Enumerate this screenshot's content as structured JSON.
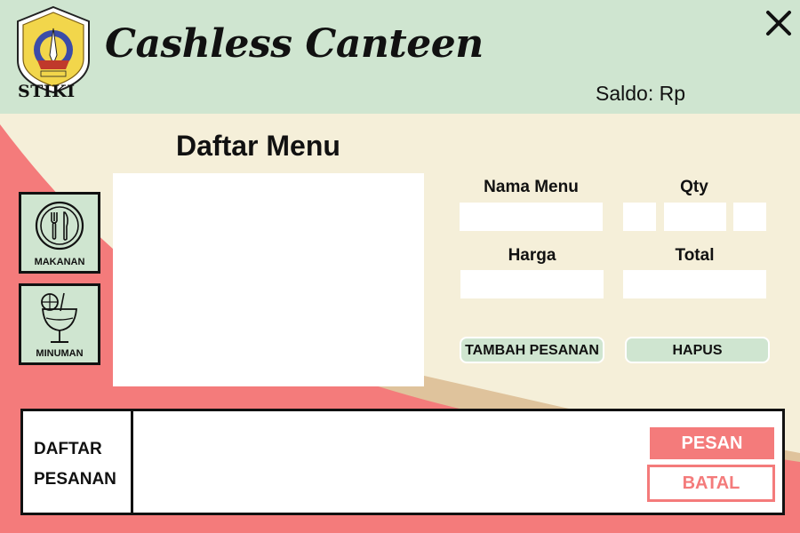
{
  "header": {
    "logo_text": "STIKI",
    "title": "Cashless Canteen",
    "saldo_label": "Saldo: Rp",
    "close_icon": "close-icon"
  },
  "menu": {
    "title": "Daftar Menu",
    "categories": [
      {
        "label": "MAKANAN",
        "icon": "utensils-icon"
      },
      {
        "label": "MINUMAN",
        "icon": "drink-glass-icon"
      }
    ]
  },
  "form": {
    "nama_menu_label": "Nama Menu",
    "qty_label": "Qty",
    "harga_label": "Harga",
    "total_label": "Total",
    "nama_menu_value": "",
    "qty_value": "",
    "harga_value": "",
    "total_value": "",
    "tambah_label": "TAMBAH PESANAN",
    "hapus_label": "HAPUS"
  },
  "order": {
    "label_line1": "DAFTAR",
    "label_line2": "PESANAN",
    "pesan_label": "PESAN",
    "batal_label": "BATAL"
  },
  "colors": {
    "header_bg": "#cfe5d0",
    "cream_bg": "#f5efd9",
    "salmon": "#f47b7b",
    "tan": "#dfc39c",
    "mint": "#cfe5d0"
  }
}
